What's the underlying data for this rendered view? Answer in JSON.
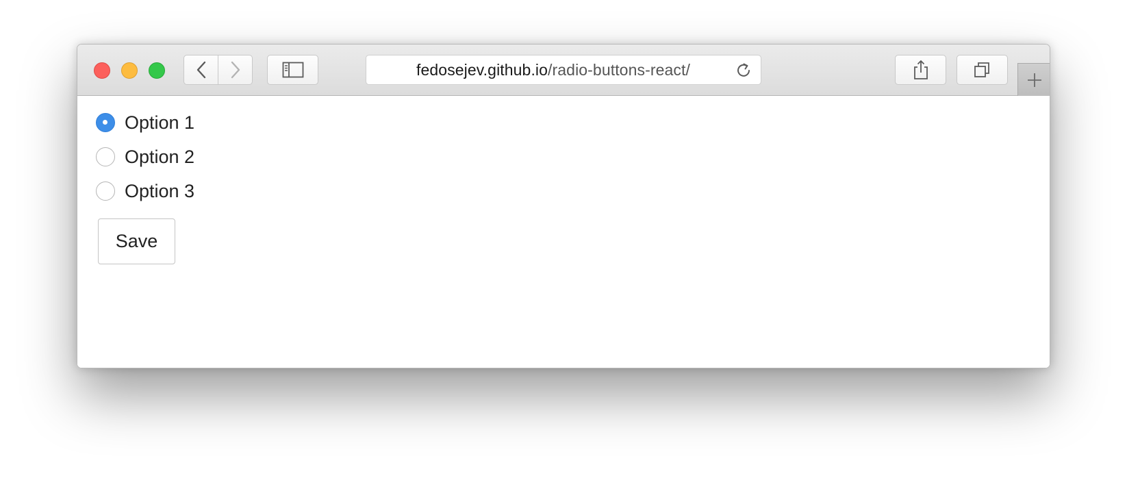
{
  "browser": {
    "url_host": "fedosejev.github.io",
    "url_path": "/radio-buttons-react/",
    "icons": {
      "back": "chevron-left-icon",
      "forward": "chevron-right-icon",
      "sidebar": "sidebar-icon",
      "reload": "reload-icon",
      "share": "share-icon",
      "tabs": "tabs-overview-icon",
      "new_tab": "plus-icon"
    },
    "traffic_colors": {
      "close": "#fc605c",
      "minimize": "#fdbc40",
      "maximize": "#34c84a"
    }
  },
  "form": {
    "options": [
      {
        "label": "Option 1",
        "checked": true
      },
      {
        "label": "Option 2",
        "checked": false
      },
      {
        "label": "Option 3",
        "checked": false
      }
    ],
    "save_label": "Save",
    "accent_color": "#3d8ee8"
  }
}
